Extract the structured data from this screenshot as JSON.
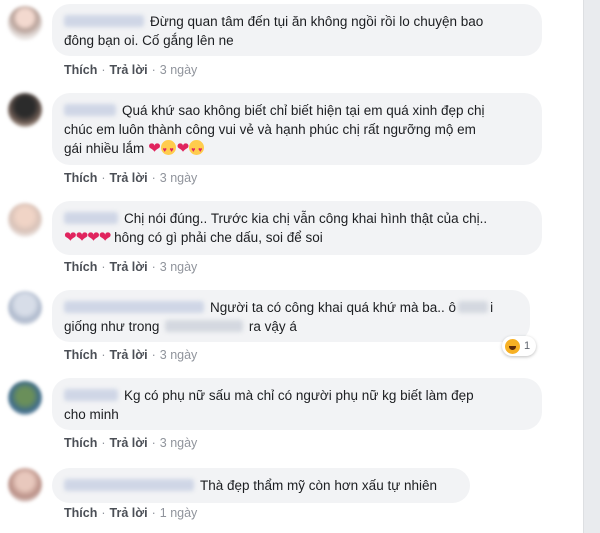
{
  "comments": [
    {
      "text_line1": "Đừng quan tâm đến tụi ăn không ngồi rồi lo chuyện bao",
      "text_line2": "đông bạn oi. Cố gắng lên ne",
      "like": "Thích",
      "reply": "Trả lời",
      "time": "3 ngày"
    },
    {
      "text_line1": "Quá khứ sao không biết chỉ biết hiện tại em quá xinh đẹp chị",
      "text_line2": "chúc em luôn thành công vui vẻ và hạnh phúc chị rất ngưỡng mộ em",
      "text_line3": "gái nhiều lắm",
      "like": "Thích",
      "reply": "Trả lời",
      "time": "3 ngày"
    },
    {
      "text_line1": "Chị nói đúng.. Trước kia chị vẫn công khai hình thật của chị..",
      "text_line2": "hông có gì phải che dấu, soi để soi",
      "like": "Thích",
      "reply": "Trả lời",
      "time": "3 ngày"
    },
    {
      "text_line1a": "Người ta có công khai quá khứ mà ba.. ô",
      "text_line1b": "i",
      "text_line2a": "giống như trong",
      "text_line2b": "ra vậy á",
      "reaction_count": "1",
      "like": "Thích",
      "reply": "Trả lời",
      "time": "3 ngày"
    },
    {
      "text_line1": "Kg có phụ nữ sấu mà chỉ có người phụ nữ kg biết làm đẹp",
      "text_line2": "cho minh",
      "like": "Thích",
      "reply": "Trả lời",
      "time": "3 ngày"
    },
    {
      "text_line1": "Thà đẹp thẩm mỹ còn hơn xấu tự nhiên",
      "like": "Thích",
      "reply": "Trả lời",
      "time": "1 ngày"
    }
  ],
  "colors": {
    "bubble": "#f2f3f5",
    "action_text": "#4b4f56",
    "heart": "#e0245e"
  },
  "icons": [
    "heart-icon",
    "heart-eyes-emoji-icon",
    "haha-reaction-icon"
  ]
}
